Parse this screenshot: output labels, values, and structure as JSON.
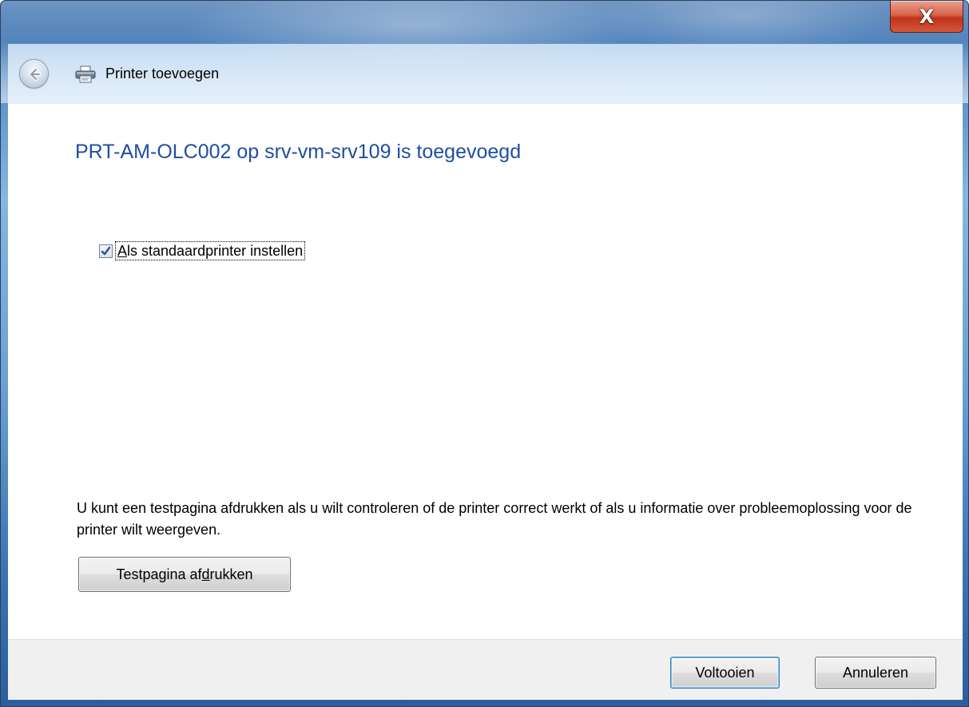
{
  "window": {
    "title": "Printer toevoegen",
    "close_label": "X"
  },
  "nav": {
    "back_label": "Back",
    "title": "Printer toevoegen",
    "icon": "printer-icon"
  },
  "main": {
    "heading": "PRT-AM-OLC002 op srv-vm-srv109 is toegevoegd",
    "default_printer": {
      "label_prefix": "",
      "label_key": "A",
      "label_rest": "ls standaardprinter instellen",
      "checked": true
    },
    "info_text": "U kunt een testpagina afdrukken als u wilt controleren of de printer correct werkt of als u informatie over probleemoplossing voor de printer wilt weergeven.",
    "test_page_button": {
      "prefix": "Testpagina af",
      "key": "d",
      "suffix": "rukken"
    }
  },
  "footer": {
    "finish_label": "Voltooien",
    "cancel_label": "Annuleren"
  },
  "colors": {
    "heading": "#1e4fa0",
    "close_button": "#c2341c",
    "footer_bg": "#f0f0f0"
  }
}
